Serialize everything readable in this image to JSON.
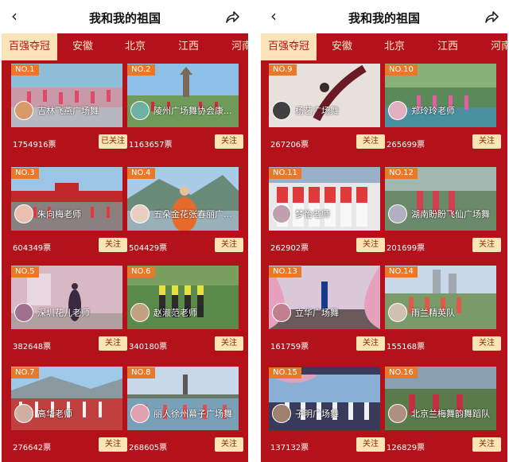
{
  "header": {
    "title": "我和我的祖国"
  },
  "tabs": [
    "百强夺冠",
    "安徽",
    "北京",
    "江西",
    "河南"
  ],
  "left": {
    "cards": [
      {
        "rank": "NO.1",
        "name": "吉林飞燕广场舞",
        "votes": "1754916票",
        "follow": "已关注"
      },
      {
        "rank": "NO.2",
        "name": "陵州广场舞协会康...",
        "votes": "1163657票",
        "follow": "关注"
      },
      {
        "rank": "NO.3",
        "name": "朱向梅老师",
        "votes": "604349票",
        "follow": "关注"
      },
      {
        "rank": "NO.4",
        "name": "五朵金花张春丽广...",
        "votes": "504429票",
        "follow": "关注"
      },
      {
        "rank": "NO.5",
        "name": "深圳花儿老师",
        "votes": "382648票",
        "follow": "关注"
      },
      {
        "rank": "NO.6",
        "name": "赵淑范老师",
        "votes": "340180票",
        "follow": "关注"
      },
      {
        "rank": "NO.7",
        "name": "高华老师",
        "votes": "276642票",
        "follow": "关注"
      },
      {
        "rank": "NO.8",
        "name": "丽人徐州幕子广场舞",
        "votes": "268605票",
        "follow": "关注"
      }
    ]
  },
  "right": {
    "cards": [
      {
        "rank": "NO.9",
        "name": "杨艺广场舞",
        "votes": "267206票",
        "follow": "关注"
      },
      {
        "rank": "NO.10",
        "name": "郑玲玲老师",
        "votes": "265699票",
        "follow": "关注"
      },
      {
        "rank": "NO.11",
        "name": "梦怡老师",
        "votes": "262902票",
        "follow": "关注"
      },
      {
        "rank": "NO.12",
        "name": "湖南盼盼飞仙广场舞",
        "votes": "201699票",
        "follow": "关注"
      },
      {
        "rank": "NO.13",
        "name": "立华广场舞",
        "votes": "161759票",
        "follow": "关注"
      },
      {
        "rank": "NO.14",
        "name": "雨兰精英队",
        "votes": "155168票",
        "follow": "关注"
      },
      {
        "rank": "NO.15",
        "name": "子明广场舞",
        "votes": "137132票",
        "follow": "关注"
      },
      {
        "rank": "NO.16",
        "name": "北京兰梅舞韵舞蹈队",
        "votes": "126829票",
        "follow": "关注"
      }
    ]
  },
  "icons": {
    "back": "back-arrow-icon",
    "share": "share-icon"
  },
  "colors": {
    "background": "#b4121a",
    "tab_active": "#fde4b8",
    "rank_badge": "#e8792b",
    "follow_button": "#fbe5b4"
  }
}
